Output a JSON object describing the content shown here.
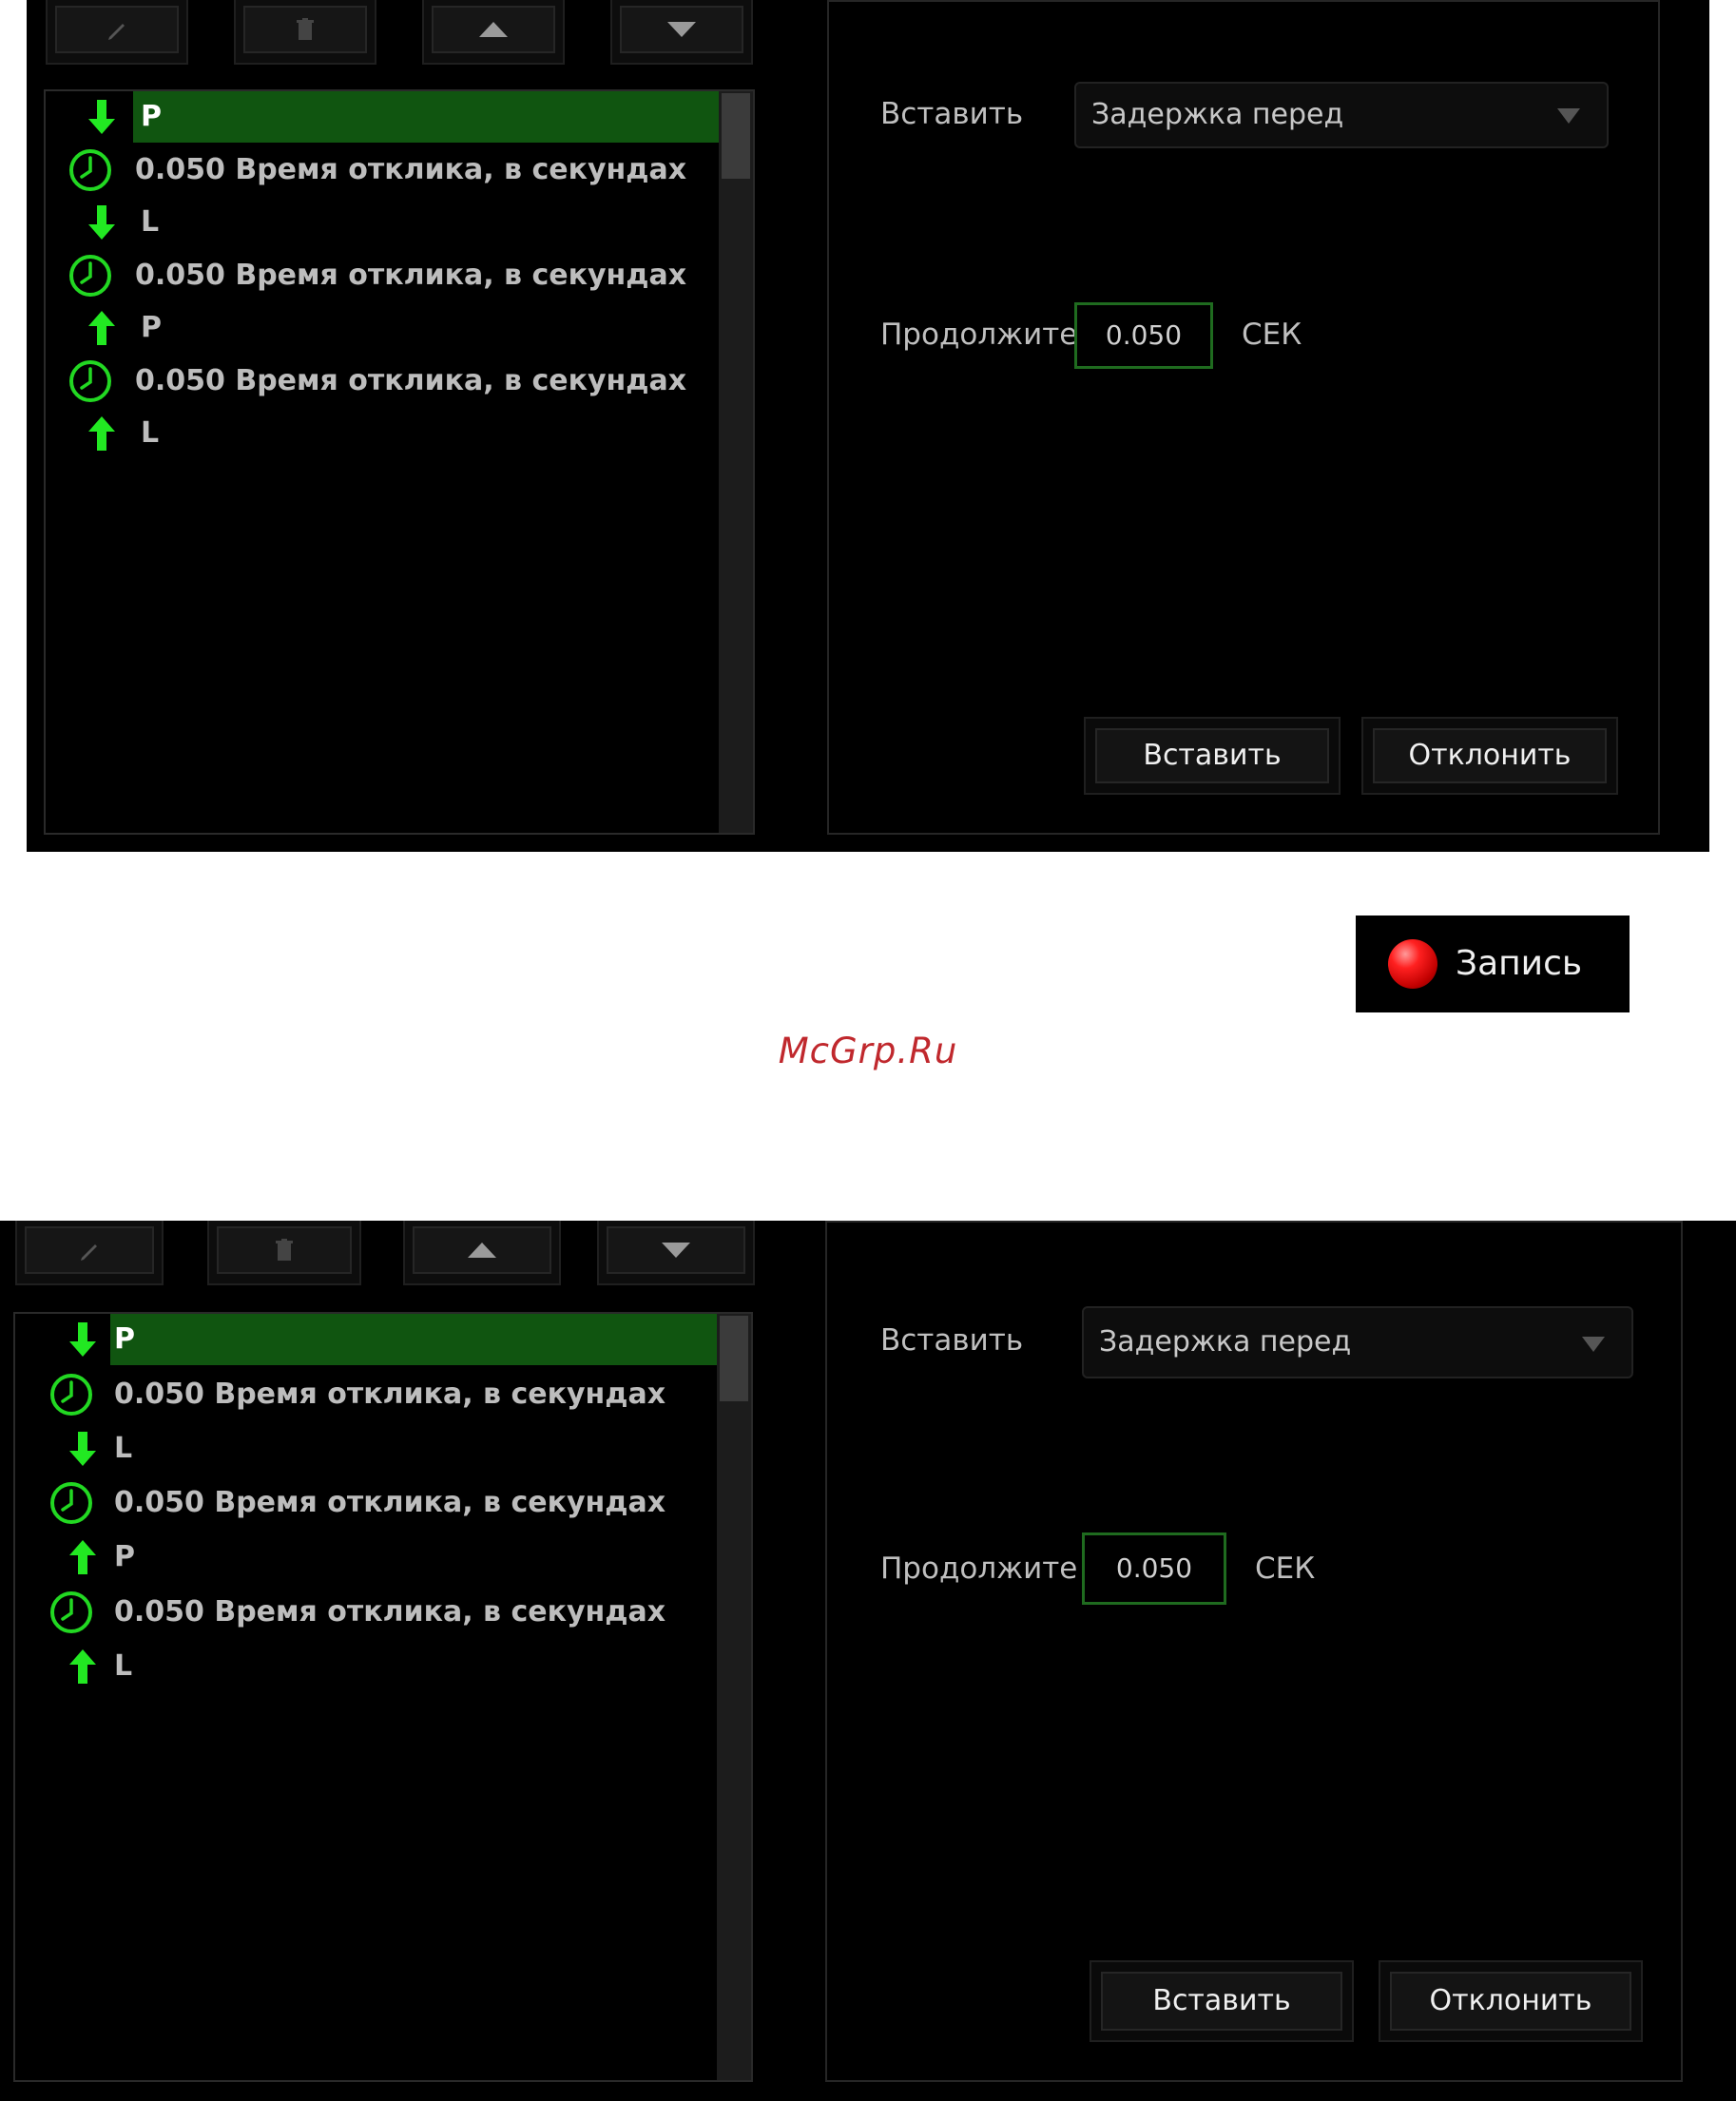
{
  "macro_panels": [
    {
      "toolbar": {
        "icons": [
          "pencil-icon",
          "trash-icon",
          "triangle-up-icon",
          "triangle-down-icon"
        ]
      },
      "list": [
        {
          "icon": "arrow-down-icon",
          "text": "P",
          "selected": true
        },
        {
          "icon": "clock-icon",
          "text": "0.050 Время отклика, в секундах"
        },
        {
          "icon": "arrow-down-icon",
          "text": "L"
        },
        {
          "icon": "clock-icon",
          "text": "0.050 Время отклика, в секундах"
        },
        {
          "icon": "arrow-up-icon",
          "text": "P"
        },
        {
          "icon": "clock-icon",
          "text": "0.050 Время отклика, в секундах"
        },
        {
          "icon": "arrow-up-icon",
          "text": "L"
        }
      ],
      "insert_label": "Вставить",
      "insert_select": "Задержка перед",
      "duration_label": "Продолжите.",
      "duration_value": "0.050",
      "unit": "СЕК",
      "insert_button": "Вставить",
      "cancel_button": "Отклонить"
    },
    {
      "toolbar": {
        "icons": [
          "pencil-icon",
          "trash-icon",
          "triangle-up-icon",
          "triangle-down-icon"
        ]
      },
      "list": [
        {
          "icon": "arrow-down-icon",
          "text": "P",
          "selected": true
        },
        {
          "icon": "clock-icon",
          "text": "0.050 Время отклика, в секундах"
        },
        {
          "icon": "arrow-down-icon",
          "text": "L"
        },
        {
          "icon": "clock-icon",
          "text": "0.050 Время отклика, в секундах"
        },
        {
          "icon": "arrow-up-icon",
          "text": "P"
        },
        {
          "icon": "clock-icon",
          "text": "0.050 Время отклика, в секундах"
        },
        {
          "icon": "arrow-up-icon",
          "text": "L"
        }
      ],
      "insert_label": "Вставить",
      "insert_select": "Задержка перед",
      "duration_label": "Продолжите.",
      "duration_value": "0.050",
      "unit": "СЕК",
      "insert_button": "Вставить",
      "cancel_button": "Отклонить"
    }
  ],
  "record_button": "Запись",
  "watermark": "McGrp.Ru",
  "colors": {
    "accent_green": "#00ff00",
    "selection_green": "#105510",
    "record_red": "#ff2020",
    "watermark_red": "#c0282d"
  }
}
